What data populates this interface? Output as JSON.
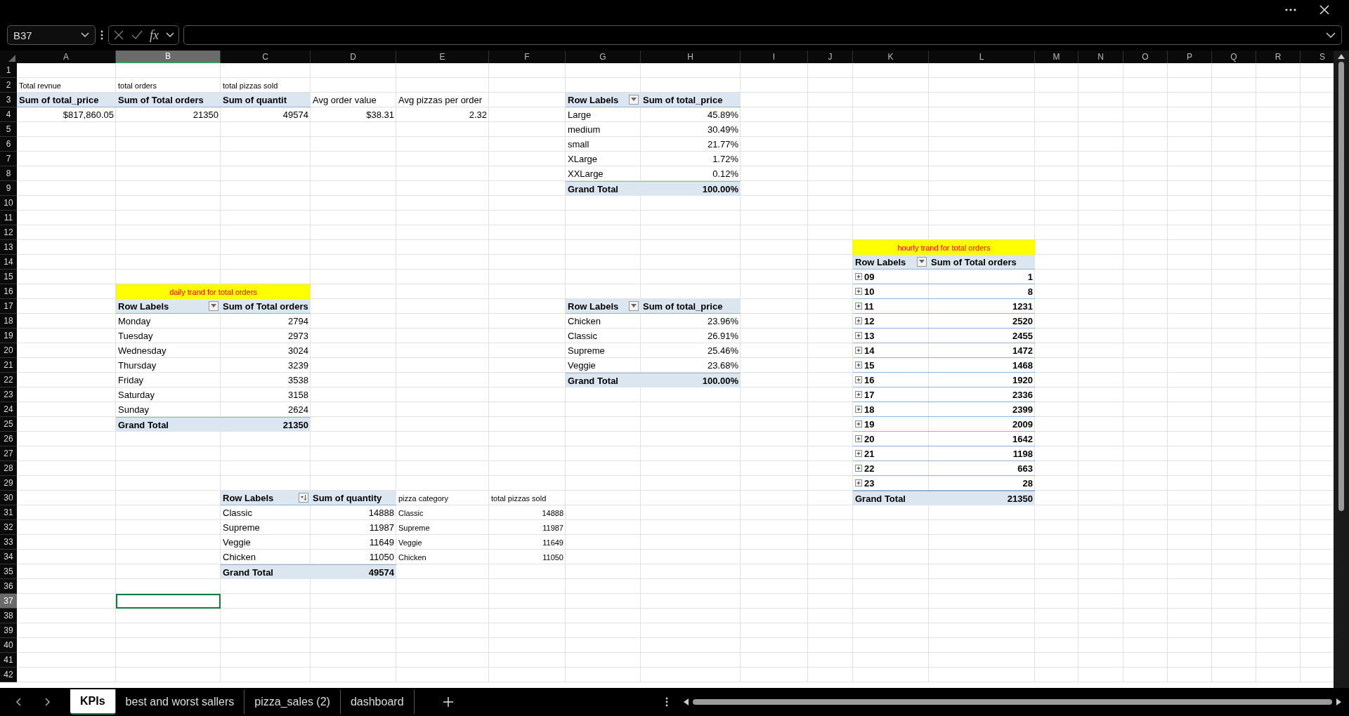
{
  "formula_bar": {
    "name_box": "B37",
    "fx": "fx"
  },
  "columns": [
    {
      "label": "A",
      "selected": false
    },
    {
      "label": "B",
      "selected": true
    },
    {
      "label": "C",
      "selected": false
    },
    {
      "label": "D",
      "selected": false
    },
    {
      "label": "E",
      "selected": false
    },
    {
      "label": "F",
      "selected": false
    },
    {
      "label": "G",
      "selected": false
    },
    {
      "label": "H",
      "selected": false
    },
    {
      "label": "I",
      "selected": false
    },
    {
      "label": "J",
      "selected": false
    },
    {
      "label": "K",
      "selected": false
    },
    {
      "label": "L",
      "selected": false
    },
    {
      "label": "M",
      "selected": false
    },
    {
      "label": "N",
      "selected": false
    },
    {
      "label": "O",
      "selected": false
    },
    {
      "label": "P",
      "selected": false
    },
    {
      "label": "Q",
      "selected": false
    },
    {
      "label": "R",
      "selected": false
    },
    {
      "label": "S",
      "selected": false
    }
  ],
  "rows": [
    {
      "number": "1",
      "selected": false
    },
    {
      "number": "2",
      "selected": false,
      "cells": {
        "A": {
          "text": "Total revnue",
          "kind": "small"
        },
        "B": {
          "text": "total orders",
          "kind": "small"
        },
        "C": {
          "text": "total pizzas sold",
          "kind": "small"
        }
      }
    },
    {
      "number": "3",
      "selected": false,
      "cells": {
        "A": {
          "text": "Sum of total_price",
          "kind": "header"
        },
        "B": {
          "text": "Sum of Total orders",
          "kind": "header"
        },
        "C": {
          "text": "Sum of quantit",
          "kind": "header"
        },
        "D": {
          "text": "Avg order value",
          "kind": "text"
        },
        "E": {
          "text": "Avg pizzas per order",
          "kind": "text"
        },
        "G": {
          "text": "Row Labels",
          "kind": "header-filter"
        },
        "H": {
          "text": "Sum of total_price",
          "kind": "header"
        }
      }
    },
    {
      "number": "4",
      "selected": false,
      "cells": {
        "A": {
          "text": "$817,860.05",
          "kind": "value"
        },
        "B": {
          "text": "21350",
          "kind": "value"
        },
        "C": {
          "text": "49574",
          "kind": "value"
        },
        "D": {
          "text": "$38.31",
          "kind": "value"
        },
        "E": {
          "text": "2.32",
          "kind": "value"
        },
        "G": {
          "text": "Large",
          "kind": "text"
        },
        "H": {
          "text": "45.89%",
          "kind": "value"
        }
      }
    },
    {
      "number": "5",
      "selected": false,
      "cells": {
        "G": {
          "text": "medium",
          "kind": "text"
        },
        "H": {
          "text": "30.49%",
          "kind": "value"
        }
      }
    },
    {
      "number": "6",
      "selected": false,
      "cells": {
        "G": {
          "text": "small",
          "kind": "text"
        },
        "H": {
          "text": "21.77%",
          "kind": "value"
        }
      }
    },
    {
      "number": "7",
      "selected": false,
      "cells": {
        "G": {
          "text": "XLarge",
          "kind": "text"
        },
        "H": {
          "text": "1.72%",
          "kind": "value"
        }
      }
    },
    {
      "number": "8",
      "selected": false,
      "cells": {
        "G": {
          "text": "XXLarge",
          "kind": "text"
        },
        "H": {
          "text": "0.12%",
          "kind": "value"
        }
      }
    },
    {
      "number": "9",
      "selected": false,
      "cells": {
        "G": {
          "text": "Grand Total",
          "kind": "total"
        },
        "H": {
          "text": "100.00%",
          "kind": "total-value"
        }
      }
    },
    {
      "number": "10",
      "selected": false
    },
    {
      "number": "11",
      "selected": false
    },
    {
      "number": "12",
      "selected": false
    },
    {
      "number": "13",
      "selected": false,
      "cells": {
        "K": {
          "text": "hourly trand for total orders",
          "kind": "title"
        }
      }
    },
    {
      "number": "14",
      "selected": false,
      "cells": {
        "K": {
          "text": "Row Labels",
          "kind": "header-filter"
        },
        "L": {
          "text": "Sum of Total orders",
          "kind": "header"
        }
      }
    },
    {
      "number": "15",
      "selected": false,
      "cells": {
        "K": {
          "text": "09",
          "kind": "hour",
          "expanded": false
        },
        "L": {
          "text": "1",
          "kind": "hour-value"
        }
      }
    },
    {
      "number": "16",
      "selected": false,
      "cells": {
        "B": {
          "text": "daily trand for total orders",
          "kind": "title"
        },
        "K": {
          "text": "10",
          "kind": "hour",
          "expanded": false
        },
        "L": {
          "text": "8",
          "kind": "hour-value"
        }
      }
    },
    {
      "number": "17",
      "selected": false,
      "cells": {
        "B": {
          "text": "Row Labels",
          "kind": "header-filter"
        },
        "C": {
          "text": "Sum of Total orders",
          "kind": "header"
        },
        "G": {
          "text": "Row Labels",
          "kind": "header-filter"
        },
        "H": {
          "text": "Sum of total_price",
          "kind": "header"
        },
        "K": {
          "text": "11",
          "kind": "hour",
          "expanded": false
        },
        "L": {
          "text": "1231",
          "kind": "hour-value"
        }
      }
    },
    {
      "number": "18",
      "selected": false,
      "cells": {
        "B": {
          "text": "Monday",
          "kind": "text"
        },
        "C": {
          "text": "2794",
          "kind": "value"
        },
        "G": {
          "text": "Chicken",
          "kind": "text"
        },
        "H": {
          "text": "23.96%",
          "kind": "value"
        },
        "K": {
          "text": "12",
          "kind": "hour",
          "expanded": false
        },
        "L": {
          "text": "2520",
          "kind": "hour-value"
        }
      }
    },
    {
      "number": "19",
      "selected": false,
      "cells": {
        "B": {
          "text": "Tuesday",
          "kind": "text"
        },
        "C": {
          "text": "2973",
          "kind": "value"
        },
        "G": {
          "text": "Classic",
          "kind": "text"
        },
        "H": {
          "text": "26.91%",
          "kind": "value"
        },
        "K": {
          "text": "13",
          "kind": "hour",
          "expanded": false
        },
        "L": {
          "text": "2455",
          "kind": "hour-value"
        }
      }
    },
    {
      "number": "20",
      "selected": false,
      "cells": {
        "B": {
          "text": "Wednesday",
          "kind": "text"
        },
        "C": {
          "text": "3024",
          "kind": "value"
        },
        "G": {
          "text": "Supreme",
          "kind": "text"
        },
        "H": {
          "text": "25.46%",
          "kind": "value"
        },
        "K": {
          "text": "14",
          "kind": "hour",
          "expanded": false
        },
        "L": {
          "text": "1472",
          "kind": "hour-value"
        }
      }
    },
    {
      "number": "21",
      "selected": false,
      "cells": {
        "B": {
          "text": "Thursday",
          "kind": "text"
        },
        "C": {
          "text": "3239",
          "kind": "value"
        },
        "G": {
          "text": "Veggie",
          "kind": "text"
        },
        "H": {
          "text": "23.68%",
          "kind": "value"
        },
        "K": {
          "text": "15",
          "kind": "hour",
          "expanded": false
        },
        "L": {
          "text": "1468",
          "kind": "hour-value"
        }
      }
    },
    {
      "number": "22",
      "selected": false,
      "cells": {
        "B": {
          "text": "Friday",
          "kind": "text"
        },
        "C": {
          "text": "3538",
          "kind": "value"
        },
        "G": {
          "text": "Grand Total",
          "kind": "total"
        },
        "H": {
          "text": "100.00%",
          "kind": "total-value"
        },
        "K": {
          "text": "16",
          "kind": "hour",
          "expanded": false
        },
        "L": {
          "text": "1920",
          "kind": "hour-value"
        }
      }
    },
    {
      "number": "23",
      "selected": false,
      "cells": {
        "B": {
          "text": "Saturday",
          "kind": "text"
        },
        "C": {
          "text": "3158",
          "kind": "value"
        },
        "K": {
          "text": "17",
          "kind": "hour",
          "expanded": false
        },
        "L": {
          "text": "2336",
          "kind": "hour-value"
        }
      }
    },
    {
      "number": "24",
      "selected": false,
      "cells": {
        "B": {
          "text": "Sunday",
          "kind": "text"
        },
        "C": {
          "text": "2624",
          "kind": "value"
        },
        "K": {
          "text": "18",
          "kind": "hour",
          "expanded": false
        },
        "L": {
          "text": "2399",
          "kind": "hour-value"
        }
      }
    },
    {
      "number": "25",
      "selected": false,
      "cells": {
        "B": {
          "text": "Grand Total",
          "kind": "total"
        },
        "C": {
          "text": "21350",
          "kind": "total-value"
        },
        "K": {
          "text": "19",
          "kind": "hour",
          "expanded": false
        },
        "L": {
          "text": "2009",
          "kind": "hour-value"
        }
      }
    },
    {
      "number": "26",
      "selected": false,
      "cells": {
        "K": {
          "text": "20",
          "kind": "hour",
          "expanded": false
        },
        "L": {
          "text": "1642",
          "kind": "hour-value"
        }
      }
    },
    {
      "number": "27",
      "selected": false,
      "cells": {
        "K": {
          "text": "21",
          "kind": "hour",
          "expanded": false
        },
        "L": {
          "text": "1198",
          "kind": "hour-value"
        }
      }
    },
    {
      "number": "28",
      "selected": false,
      "cells": {
        "K": {
          "text": "22",
          "kind": "hour",
          "expanded": false
        },
        "L": {
          "text": "663",
          "kind": "hour-value"
        }
      }
    },
    {
      "number": "29",
      "selected": false,
      "cells": {
        "K": {
          "text": "23",
          "kind": "hour",
          "expanded": false
        },
        "L": {
          "text": "28",
          "kind": "hour-value"
        }
      }
    },
    {
      "number": "30",
      "selected": false,
      "cells": {
        "C": {
          "text": "Row Labels",
          "kind": "header-sort"
        },
        "D": {
          "text": "Sum of quantity",
          "kind": "header"
        },
        "E": {
          "text": "pizza category",
          "kind": "small"
        },
        "F": {
          "text": "total pizzas sold",
          "kind": "small"
        },
        "K": {
          "text": "Grand Total",
          "kind": "total"
        },
        "L": {
          "text": "21350",
          "kind": "total-value"
        }
      }
    },
    {
      "number": "31",
      "selected": false,
      "cells": {
        "C": {
          "text": "Classic",
          "kind": "text"
        },
        "D": {
          "text": "14888",
          "kind": "value"
        },
        "E": {
          "text": "Classic",
          "kind": "small"
        },
        "F": {
          "text": "14888",
          "kind": "small-value"
        }
      }
    },
    {
      "number": "32",
      "selected": false,
      "cells": {
        "C": {
          "text": "Supreme",
          "kind": "text"
        },
        "D": {
          "text": "11987",
          "kind": "value"
        },
        "E": {
          "text": "Supreme",
          "kind": "small"
        },
        "F": {
          "text": "11987",
          "kind": "small-value"
        }
      }
    },
    {
      "number": "33",
      "selected": false,
      "cells": {
        "C": {
          "text": "Veggie",
          "kind": "text"
        },
        "D": {
          "text": "11649",
          "kind": "value"
        },
        "E": {
          "text": "Veggie",
          "kind": "small"
        },
        "F": {
          "text": "11649",
          "kind": "small-value"
        }
      }
    },
    {
      "number": "34",
      "selected": false,
      "cells": {
        "C": {
          "text": "Chicken",
          "kind": "text"
        },
        "D": {
          "text": "11050",
          "kind": "value"
        },
        "E": {
          "text": "Chicken",
          "kind": "small"
        },
        "F": {
          "text": "11050",
          "kind": "small-value"
        }
      }
    },
    {
      "number": "35",
      "selected": false,
      "cells": {
        "C": {
          "text": "Grand Total",
          "kind": "total"
        },
        "D": {
          "text": "49574",
          "kind": "total-value"
        }
      }
    },
    {
      "number": "36",
      "selected": false
    },
    {
      "number": "37",
      "selected": true
    },
    {
      "number": "38",
      "selected": false
    },
    {
      "number": "39",
      "selected": false
    },
    {
      "number": "40",
      "selected": false
    },
    {
      "number": "41",
      "selected": false
    },
    {
      "number": "42",
      "selected": false
    }
  ],
  "sheet_tabs": [
    {
      "label": "KPIs",
      "selected": true
    },
    {
      "label": "best and worst sallers",
      "selected": false
    },
    {
      "label": "pizza_sales (2)",
      "selected": false
    },
    {
      "label": "dashboard",
      "selected": false
    }
  ]
}
